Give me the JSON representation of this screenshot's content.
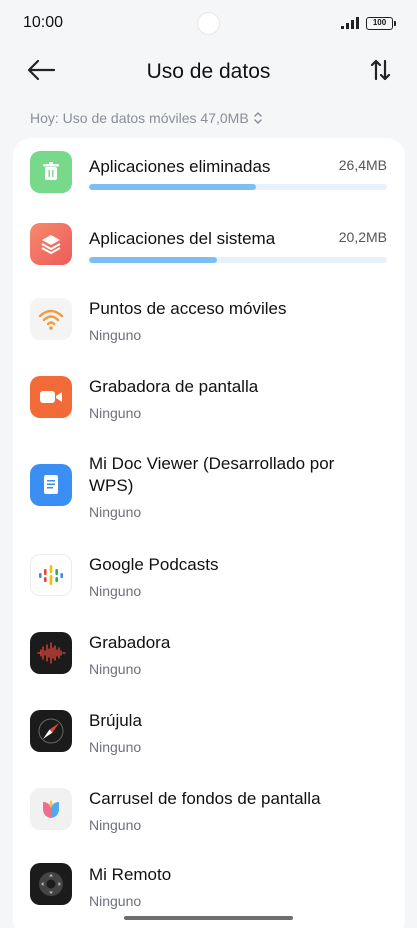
{
  "status_bar": {
    "time": "10:00",
    "battery": "100"
  },
  "header": {
    "title": "Uso de datos"
  },
  "summary": {
    "text": "Hoy: Uso de datos móviles 47,0MB",
    "chevron": "⌃⌄"
  },
  "apps": [
    {
      "name": "Aplicaciones eliminadas",
      "size": "26,4MB",
      "usage_fraction": 0.56,
      "icon": "trash-icon",
      "icon_color": "#79d98a"
    },
    {
      "name": "Aplicaciones del sistema",
      "size": "20,2MB",
      "usage_fraction": 0.43,
      "icon": "layers-icon",
      "icon_color": "#f26b5e"
    },
    {
      "name": "Puntos de acceso móviles",
      "sub": "Ninguno",
      "icon": "hotspot-icon",
      "icon_color": "#f4f4f4"
    },
    {
      "name": "Grabadora de pantalla",
      "sub": "Ninguno",
      "icon": "video-icon",
      "icon_color": "#f26a37"
    },
    {
      "name_line1": "Mi Doc Viewer (Desarrollado por",
      "name_line2": "WPS)",
      "sub": "Ninguno",
      "icon": "document-icon",
      "icon_color": "#3b8ff2"
    },
    {
      "name": "Google Podcasts",
      "sub": "Ninguno",
      "icon": "podcasts-icon",
      "icon_color": "#ffffff"
    },
    {
      "name": "Grabadora",
      "sub": "Ninguno",
      "icon": "waveform-icon",
      "icon_color": "#1b1b1b"
    },
    {
      "name": "Brújula",
      "sub": "Ninguno",
      "icon": "compass-icon",
      "icon_color": "#1b1b1b"
    },
    {
      "name": "Carrusel de fondos de pantalla",
      "sub": "Ninguno",
      "icon": "wallpaper-icon",
      "icon_color": "#f1f1f1"
    },
    {
      "name": "Mi Remoto",
      "sub": "Ninguno",
      "icon": "remote-icon",
      "icon_color": "#1b1b1b"
    }
  ]
}
